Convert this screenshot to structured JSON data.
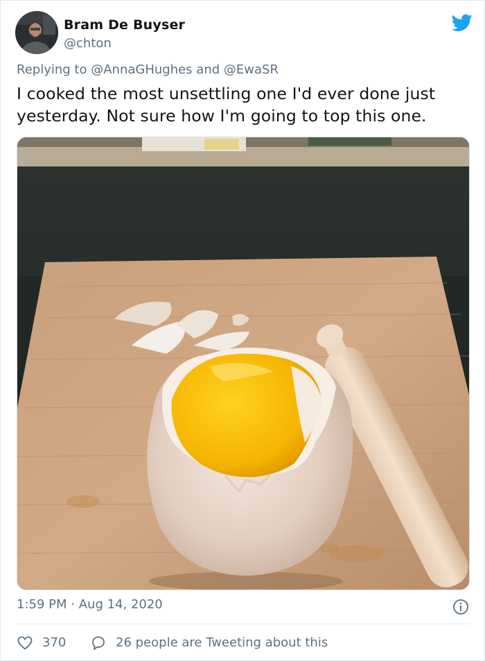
{
  "user": {
    "name": "Bram De Buyser",
    "handle": "@chton",
    "avatar_icon": "profile-photo"
  },
  "brand": {
    "icon": "twitter-bird-icon",
    "color": "#1da1f2"
  },
  "reply": {
    "prefix": "Replying to",
    "mention_1": "@AnnaGHughes",
    "conjunction": "and",
    "mention_2": "@EwaSR"
  },
  "tweet": {
    "text": "I cooked the most unsettling one I'd ever done just yesterday. Not sure how I'm going to top this one."
  },
  "media": {
    "icon": "photo-egg-yolk-on-cutting-board"
  },
  "meta": {
    "time": "1:59 PM",
    "separator": "·",
    "date": "Aug 14, 2020",
    "info_icon": "info-icon"
  },
  "actions": {
    "like_icon": "heart-icon",
    "like_count": "370",
    "reply_icon": "speech-bubble-icon",
    "reply_text": "26 people are Tweeting about this"
  },
  "colors": {
    "text": "#0f1419",
    "secondary": "#5b7083",
    "border": "#e1e8ed"
  }
}
